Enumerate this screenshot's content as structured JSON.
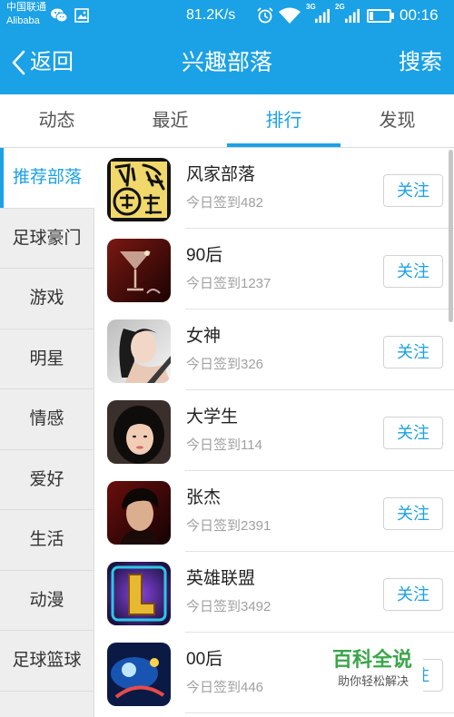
{
  "status_bar": {
    "carrier": "中国联通",
    "carrier_sub": "Alibaba",
    "net_speed": "81.2K/s",
    "network_1": "3G",
    "network_2": "2G",
    "time": "00:16",
    "battery_level": 0.2,
    "icons": [
      "wechat-icon",
      "image-icon",
      "alarm-icon",
      "wifi-icon",
      "signal-icon",
      "battery-icon"
    ]
  },
  "header": {
    "back_label": "返回",
    "title": "兴趣部落",
    "search_label": "搜索"
  },
  "tabs": [
    {
      "label": "动态",
      "active": false
    },
    {
      "label": "最近",
      "active": false
    },
    {
      "label": "排行",
      "active": true
    },
    {
      "label": "发现",
      "active": false
    }
  ],
  "sidebar": {
    "items": [
      "推荐部落",
      "足球豪门",
      "游戏",
      "明星",
      "情感",
      "爱好",
      "生活",
      "动漫",
      "足球篮球"
    ],
    "active_index": 0
  },
  "follow_label": "关注",
  "tribes": [
    {
      "name": "风家部落",
      "checkins": "今日签到482"
    },
    {
      "name": "90后",
      "checkins": "今日签到1237"
    },
    {
      "name": "女神",
      "checkins": "今日签到326"
    },
    {
      "name": "大学生",
      "checkins": "今日签到114"
    },
    {
      "name": "张杰",
      "checkins": "今日签到2391"
    },
    {
      "name": "英雄联盟",
      "checkins": "今日签到3492"
    },
    {
      "name": "00后",
      "checkins": "今日签到446"
    }
  ],
  "watermark": {
    "brand": "百科全说",
    "slogan": "助你轻松解决"
  },
  "colors": {
    "primary": "#1ba1e6",
    "sidebar_bg": "#eeeeee",
    "secondary_text": "#a0a0a0",
    "watermark_green": "#3aa64a"
  }
}
